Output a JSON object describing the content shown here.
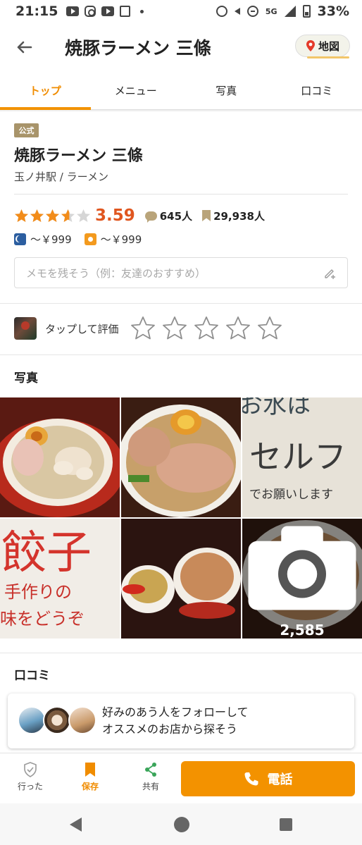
{
  "status_bar": {
    "time": "21:15",
    "network": "5G",
    "battery": "33%"
  },
  "header": {
    "title": "焼豚ラーメン 三條",
    "map_label": "地図"
  },
  "tabs": [
    {
      "label": "トップ",
      "active": true
    },
    {
      "label": "メニュー",
      "active": false
    },
    {
      "label": "写真",
      "active": false
    },
    {
      "label": "口コミ",
      "active": false
    }
  ],
  "store": {
    "badge": "公式",
    "name": "焼豚ラーメン 三條",
    "subtitle": "玉ノ井駅 / ラーメン",
    "rating": "3.59",
    "rating_value": 3.59,
    "review_count": "645人",
    "save_count": "29,938人",
    "dinner_price": "～￥999",
    "lunch_price": "～￥999",
    "memo_placeholder": "メモを残そう（例：友達のおすすめ）"
  },
  "rate_prompt": {
    "label": "タップして評価",
    "stars": 5
  },
  "photos": {
    "title": "写真",
    "count": "2,585"
  },
  "reviews": {
    "title": "口コミ",
    "follow_line1": "好みのあう人をフォローして",
    "follow_line2": "オススメのお店から探そう"
  },
  "actions": {
    "went": "行った",
    "save": "保存",
    "share": "共有",
    "call": "電話"
  },
  "colors": {
    "accent": "#f39200",
    "rating": "#e0561f",
    "star": "#f28c1a"
  }
}
